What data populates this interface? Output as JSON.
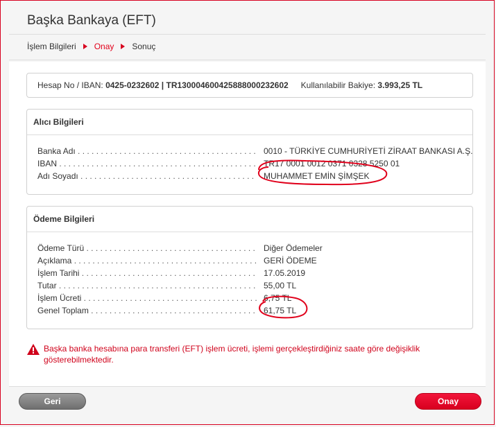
{
  "page": {
    "title": "Başka Bankaya (EFT)"
  },
  "steps": [
    {
      "label": "İşlem Bilgileri"
    },
    {
      "label": "Onay"
    },
    {
      "label": "Sonuç"
    }
  ],
  "account": {
    "label": "Hesap No / IBAN:",
    "value": "0425-0232602 | TR130004600425888000232602",
    "balance_label": "Kullanılabilir Bakiye:",
    "balance_value": "3.993,25 TL"
  },
  "recipient": {
    "header": "Alıcı Bilgileri",
    "rows": [
      {
        "label": "Banka Adı",
        "value": "0010 - TÜRKİYE CUMHURİYETİ ZİRAAT BANKASI A.Ş."
      },
      {
        "label": "IBAN",
        "value": "TR17 0001 0012 0371 0328 5250 01"
      },
      {
        "label": "Adı Soyadı",
        "value": "MUHAMMET EMİN ŞİMŞEK"
      }
    ]
  },
  "payment": {
    "header": "Ödeme Bilgileri",
    "rows": [
      {
        "label": "Ödeme Türü",
        "value": "Diğer Ödemeler"
      },
      {
        "label": "Açıklama",
        "value": "GERİ ÖDEME"
      },
      {
        "label": "İşlem Tarihi",
        "value": "17.05.2019"
      },
      {
        "label": "Tutar",
        "value": "55,00 TL"
      },
      {
        "label": "İşlem Ücreti",
        "value": "6,75 TL"
      },
      {
        "label": "Genel Toplam",
        "value": "61,75 TL"
      }
    ]
  },
  "warning": {
    "text": "Başka banka hesabına para transferi (EFT) işlem ücreti, işlemi gerçekleştirdiğiniz saate göre değişiklik gösterebilmektedir.",
    "icon": "warning-triangle-icon"
  },
  "buttons": {
    "back": "Geri",
    "confirm": "Onay"
  },
  "colors": {
    "accent": "#e2001a",
    "annotation": "#e0001b"
  }
}
